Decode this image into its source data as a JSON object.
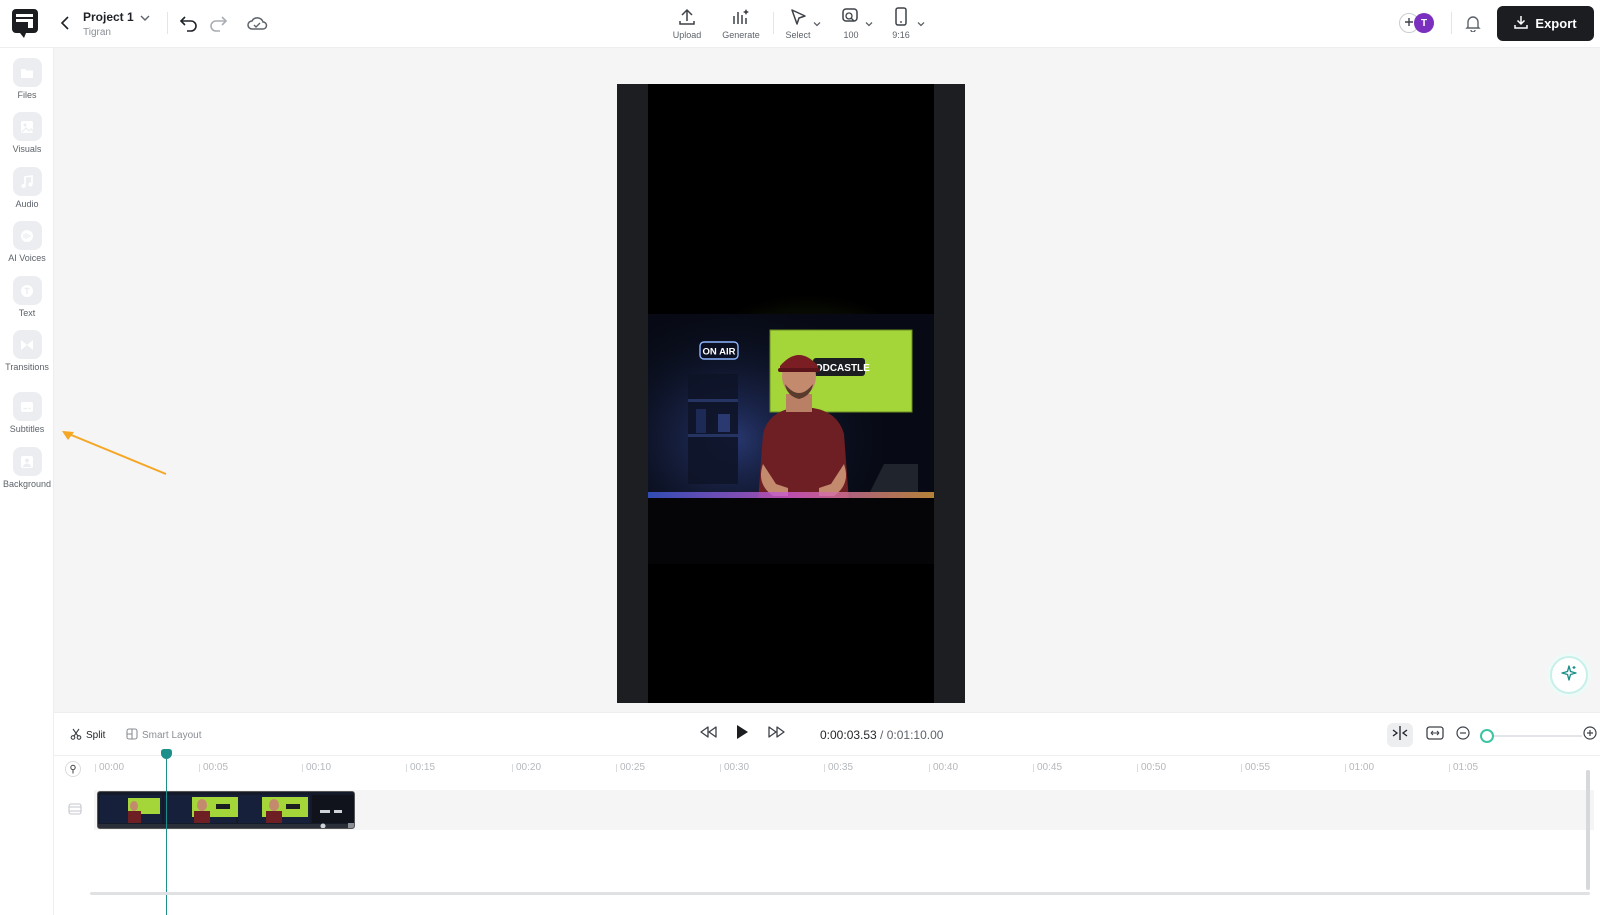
{
  "header": {
    "project_name": "Project 1",
    "owner": "Tigran",
    "tools": [
      {
        "label": "Upload",
        "icon": "upload-icon"
      },
      {
        "label": "Generate",
        "icon": "generate-icon"
      },
      {
        "label": "Select",
        "icon": "cursor-icon"
      },
      {
        "label": "100",
        "icon": "zoom-icon"
      },
      {
        "label": "9:16",
        "icon": "phone-ratio-icon"
      }
    ],
    "avatar_initial": "T",
    "export_label": "Export"
  },
  "sidebar": {
    "items": [
      {
        "label": "Files",
        "icon": "folder-icon"
      },
      {
        "label": "Visuals",
        "icon": "visuals-icon"
      },
      {
        "label": "Audio",
        "icon": "music-note-icon"
      },
      {
        "label": "AI Voices",
        "icon": "voice-wave-icon"
      },
      {
        "label": "Text",
        "icon": "text-icon"
      },
      {
        "label": "Transitions",
        "icon": "transition-icon"
      },
      {
        "label": "Subtitles",
        "icon": "subtitles-icon"
      },
      {
        "label": "Background",
        "icon": "background-icon"
      }
    ]
  },
  "preview": {
    "sign_text": "ON AIR",
    "screen_text": "PODCASTLE"
  },
  "timeline": {
    "split_label": "Split",
    "smart_layout_label": "Smart Layout",
    "current_time": "0:00:03.53",
    "separator": " / ",
    "total_time": "0:01:10.00",
    "ticks": [
      "00:00",
      "00:05",
      "00:10",
      "00:15",
      "00:20",
      "00:25",
      "00:30",
      "00:35",
      "00:40",
      "00:45",
      "00:50",
      "00:55",
      "01:00",
      "01:05"
    ]
  },
  "colors": {
    "accent": "#1d8f8a",
    "export_bg": "#1b1d21",
    "avatar": "#7b2fbf",
    "arrow": "#f5a623",
    "screen_green": "#a4d63a"
  }
}
